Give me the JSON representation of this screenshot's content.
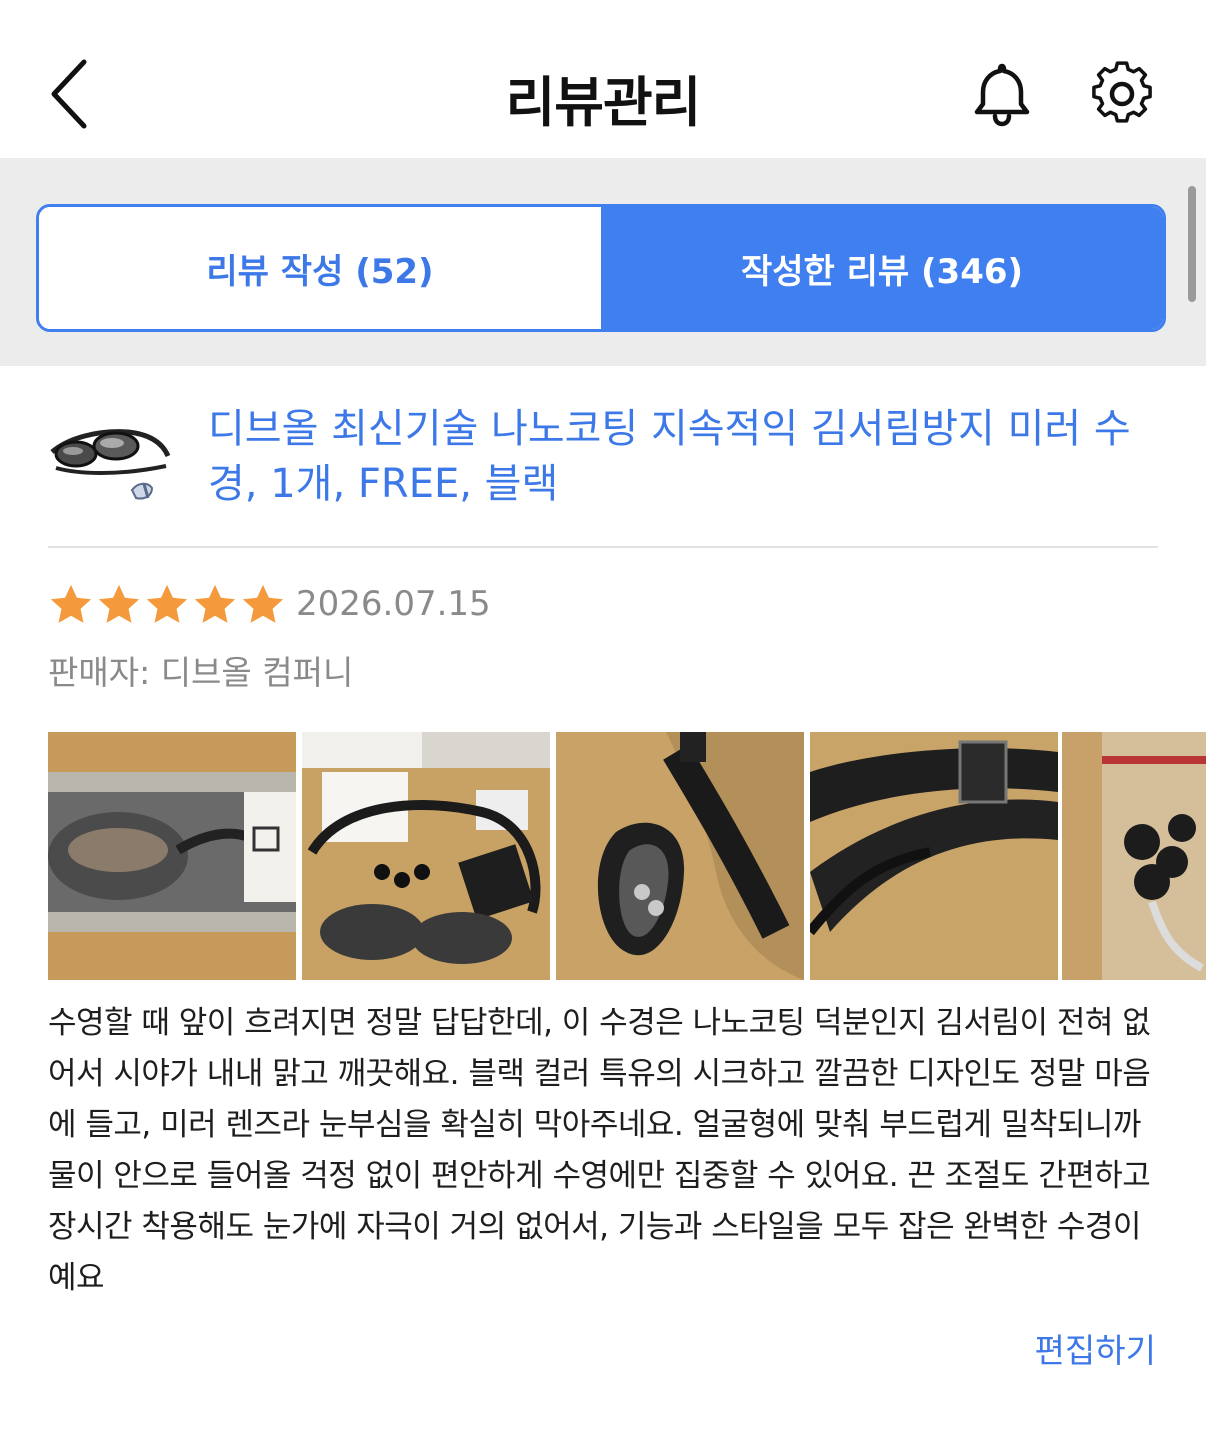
{
  "header": {
    "title": "리뷰관리"
  },
  "tabs": [
    {
      "label": "리뷰 작성 (52)",
      "active": false
    },
    {
      "label": "작성한 리뷰 (346)",
      "active": true
    }
  ],
  "colors": {
    "accent": "#3f7ff0",
    "star": "#f59a3c",
    "muted_text": "#8a8a8a"
  },
  "review": {
    "product_title": "디브올 최신기술 나노코팅 지속적익 김서림방지 미러 수경, 1개, FREE, 블랙",
    "rating": 5,
    "max_rating": 5,
    "date": "2026.07.15",
    "seller": "판매자: 디브올 컴퍼니",
    "photo_count_visible": 5,
    "text": "수영할 때 앞이 흐려지면 정말 답답한데, 이 수경은 나노코팅 덕분인지 김서림이 전혀 없어서 시야가 내내 맑고 깨끗해요. 블랙 컬러 특유의 시크하고 깔끔한 디자인도 정말 마음에 들고, 미러 렌즈라 눈부심을 확실히 막아주네요. 얼굴형에 맞춰 부드럽게 밀착되니까 물이 안으로 들어올 걱정 없이 편안하게 수영에만 집중할 수 있어요. 끈 조절도 간편하고 장시간 착용해도 눈가에 자극이 거의 없어서, 기능과 스타일을 모두 잡은 완벽한 수경이예요",
    "edit_label": "편집하기"
  },
  "icons": {
    "back": "chevron-left-icon",
    "bell": "bell-icon",
    "settings": "gear-icon"
  }
}
